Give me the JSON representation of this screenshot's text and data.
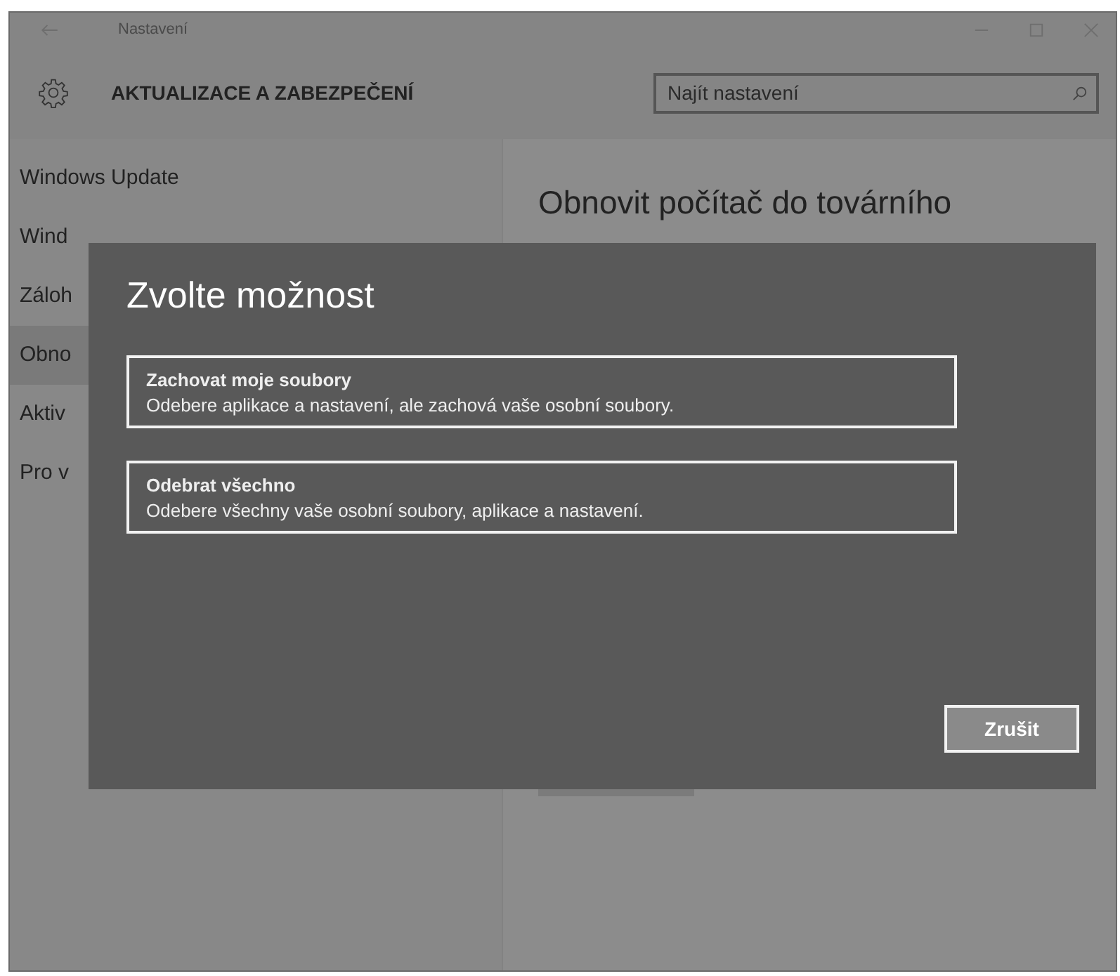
{
  "window": {
    "title": "Nastavení"
  },
  "header": {
    "title": "AKTUALIZACE A ZABEZPEČENÍ",
    "search": {
      "placeholder": "Najít nastavení"
    }
  },
  "sidebar": {
    "items": [
      {
        "label": "Windows Update",
        "selected": false
      },
      {
        "label": "Wind",
        "selected": false
      },
      {
        "label": "Záloh",
        "selected": false
      },
      {
        "label": "Obno",
        "selected": true
      },
      {
        "label": "Aktiv",
        "selected": false
      },
      {
        "label": "Pro v",
        "selected": false
      }
    ]
  },
  "content": {
    "heading": "Obnovit počítač do továrního"
  },
  "dialog": {
    "title": "Zvolte možnost",
    "options": [
      {
        "title": "Zachovat moje soubory",
        "description": "Odebere aplikace a nastavení, ale zachová vaše osobní soubory."
      },
      {
        "title": "Odebrat všechno",
        "description": "Odebere všechny vaše osobní soubory, aplikace a nastavení."
      }
    ],
    "cancel": "Zrušit"
  }
}
